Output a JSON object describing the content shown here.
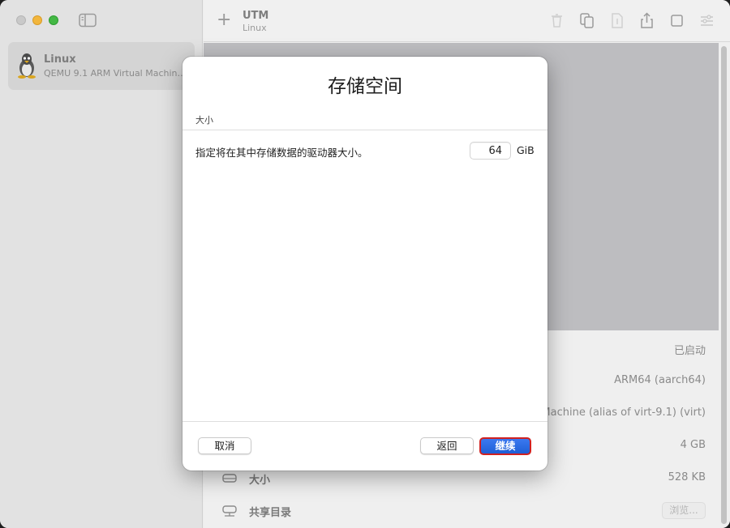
{
  "sidebar": {
    "vm": {
      "name": "Linux",
      "description": "QEMU 9.1 ARM Virtual Machin…"
    }
  },
  "toolbar": {
    "title": "UTM",
    "subtitle": "Linux",
    "add_label": "+",
    "icons": [
      "trash-icon",
      "clone-icon",
      "download-icon",
      "share-icon",
      "stop-icon",
      "settings-icon"
    ]
  },
  "details": {
    "status_value": "已启动",
    "arch_value": "ARM64 (aarch64)",
    "machine_value": "l Machine (alias of virt-9.1) (virt)",
    "memory_value": "4 GB",
    "size_label": "大小",
    "size_value": "528 KB",
    "shared_label": "共享目录",
    "browse_label": "浏览..."
  },
  "sheet": {
    "title": "存储空间",
    "section_label": "大小",
    "field_label": "指定将在其中存储数据的驱动器大小。",
    "size_value": "64",
    "unit": "GiB",
    "cancel_label": "取消",
    "back_label": "返回",
    "continue_label": "继续"
  },
  "colors": {
    "accent": "#2a69e2",
    "highlight_border": "#d02121"
  }
}
